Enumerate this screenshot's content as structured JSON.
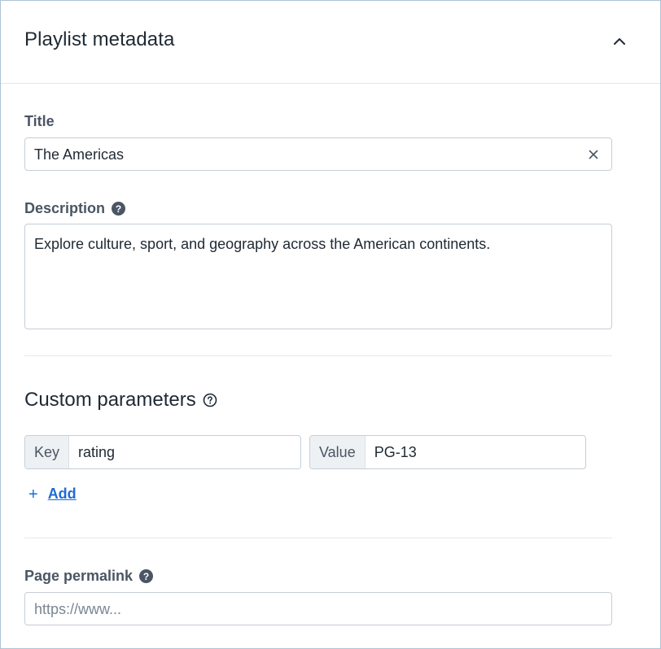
{
  "header": {
    "title": "Playlist metadata",
    "collapse_icon": "chevron-up-icon"
  },
  "title_field": {
    "label": "Title",
    "value": "The Americas",
    "clear_icon": "close-icon"
  },
  "description_field": {
    "label": "Description",
    "help_icon": "help-icon",
    "help_glyph": "?",
    "value": "Explore culture, sport, and geography across the American continents."
  },
  "custom_parameters": {
    "title": "Custom parameters",
    "help_icon": "help-outline-icon",
    "key_addon": "Key",
    "key_value": "rating",
    "value_addon": "Value",
    "value_value": "PG-13",
    "add_label": "Add",
    "add_glyph": "+"
  },
  "permalink_field": {
    "label": "Page permalink",
    "help_icon": "help-icon",
    "help_glyph": "?",
    "placeholder": "https://www..."
  },
  "colors": {
    "accent": "#1e6bd6",
    "label": "#4b5563",
    "border": "#c5ced8",
    "panel_border": "#aec3d4"
  }
}
